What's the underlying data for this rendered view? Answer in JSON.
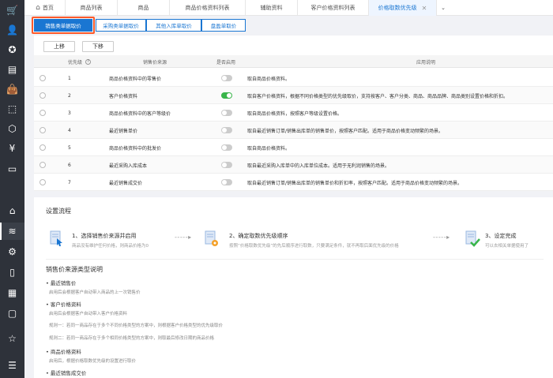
{
  "sidebar": {
    "items": [
      {
        "icon": "cart-icon",
        "glyph": "🛒"
      },
      {
        "icon": "user-icon",
        "glyph": "👤"
      },
      {
        "icon": "star-badge-icon",
        "glyph": "✪"
      },
      {
        "icon": "report-icon",
        "glyph": "▤"
      },
      {
        "icon": "bag-icon",
        "glyph": "👜"
      },
      {
        "icon": "box-icon",
        "glyph": "⬚"
      },
      {
        "icon": "cube-icon",
        "glyph": "⬡"
      },
      {
        "icon": "yen-icon",
        "glyph": "¥"
      },
      {
        "icon": "monitor-icon",
        "glyph": "▭"
      },
      {
        "icon": "warehouse-icon",
        "glyph": "⌂"
      },
      {
        "icon": "layers-icon",
        "glyph": "≋"
      },
      {
        "icon": "settings-icon",
        "glyph": "⚙"
      },
      {
        "icon": "clipboard-icon",
        "glyph": "▯"
      },
      {
        "icon": "apps-icon",
        "glyph": "▦"
      },
      {
        "icon": "message-icon",
        "glyph": "▢"
      },
      {
        "icon": "favorite-icon",
        "glyph": "☆"
      },
      {
        "icon": "menu-collapse-icon",
        "glyph": "☰"
      }
    ]
  },
  "tabs": {
    "home": "首页",
    "items": [
      "商品列表",
      "商品",
      "商品价格资料列表",
      "辅助资料",
      "客户价格资料列表",
      "价格取数优先级"
    ]
  },
  "subtabs": [
    "销售类单据取价",
    "采购类单据取价",
    "其他入库单取价",
    "盘盈单取价"
  ],
  "toolbar": {
    "up": "上移",
    "down": "下移"
  },
  "table": {
    "headers": {
      "priority": "优先级",
      "source": "销售价来源",
      "enabled": "是否启用",
      "desc": "应用说明"
    },
    "rows": [
      {
        "priority": "1",
        "source": "商品价格资料中的零售价",
        "enabled": false,
        "desc": "取自商品价格资料。"
      },
      {
        "priority": "2",
        "source": "客户价格资料",
        "enabled": true,
        "desc": "取自客户价格资料，根据不同价格类型的优先级取价，支持按客户、客户分类、商品、商品品牌、商品类别设置价格和折扣。"
      },
      {
        "priority": "3",
        "source": "商品价格资料中的客户等级价",
        "enabled": false,
        "desc": "取自商品价格资料，按照客户等级设置价格。"
      },
      {
        "priority": "4",
        "source": "最近销售单价",
        "enabled": false,
        "desc": "取自最近销售订单/销售出库单的销售单价，按照客户匹配。适用于商品价格变动频繁的场景。"
      },
      {
        "priority": "5",
        "source": "商品价格资料中的批发价",
        "enabled": false,
        "desc": "取自商品价格资料。"
      },
      {
        "priority": "6",
        "source": "最近采购入库成本",
        "enabled": false,
        "desc": "取自最近采购入库单中的入库单位成本。适用于无利润销售的场景。"
      },
      {
        "priority": "7",
        "source": "最近销售成交价",
        "enabled": false,
        "desc": "取自最近销售订单/销售出库单的销售单价和折扣率，按照客户匹配。适用于商品价格变动频繁的场景。"
      }
    ]
  },
  "flow": {
    "title": "设置流程",
    "steps": [
      {
        "title": "1、选择销售价来源并启用",
        "desc": "商品没有维护任何价格，则商品价格为0"
      },
      {
        "title": "2、确定取数优先级顺序",
        "desc": "按照“价格取数优先级”的先后顺序进行取数，只要满足条件，就不再取后面优先级的价格"
      },
      {
        "title": "3、设定完成",
        "desc": "可以去相关单据使用了"
      }
    ]
  },
  "explain": {
    "title": "销售价来源类型说明",
    "items": [
      {
        "label": "• 最近销售价",
        "lines": [
          "启用后会根据客户自动带入商品的上一次销售价"
        ]
      },
      {
        "label": "• 客户价格资料",
        "lines": [
          "启用后会根据客户自动带入客户价格资料",
          "规则一：若同一商品存在于多个不同价格类型的方案中，则根据客户价格类型的优先级取价",
          "规则二：若同一商品存在于多个相同价格类型的方案中，则取最后修改日期的商品价格"
        ]
      },
      {
        "label": "• 商品价格资料",
        "lines": [
          "启用后，根据价格取数优先级的设置进行取价"
        ]
      },
      {
        "label": "• 最近销售成交价",
        "lines": []
      }
    ]
  },
  "colors": {
    "accent": "#1a76d2",
    "highlight": "#ff5a2a",
    "toggle_on": "#39b54a"
  }
}
